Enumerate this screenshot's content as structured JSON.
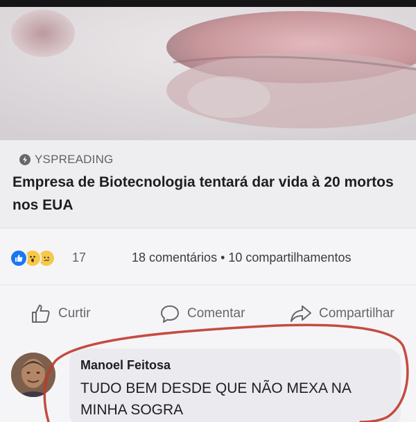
{
  "post": {
    "source": "YSPREADING",
    "headline": "Empresa de Biotecnologia tentará dar vida à 20 mortos nos EUA",
    "source_icon": "lightning-icon"
  },
  "engagement": {
    "reactions": [
      "like",
      "wow",
      "sad"
    ],
    "reaction_count": "17",
    "stats": "18 comentários • 10 compartilhamentos"
  },
  "actions": {
    "like_label": "Curtir",
    "comment_label": "Comentar",
    "share_label": "Compartilhar"
  },
  "comment": {
    "author": "Manoel Feitosa",
    "text": "TUDO BEM DESDE QUE NÃO MEXA NA MINHA SOGRA"
  },
  "colors": {
    "topbar": "#151515",
    "like_blue": "#1877f2",
    "reaction_yellow": "#f7c84a",
    "annotation_circle": "#c0392b"
  }
}
